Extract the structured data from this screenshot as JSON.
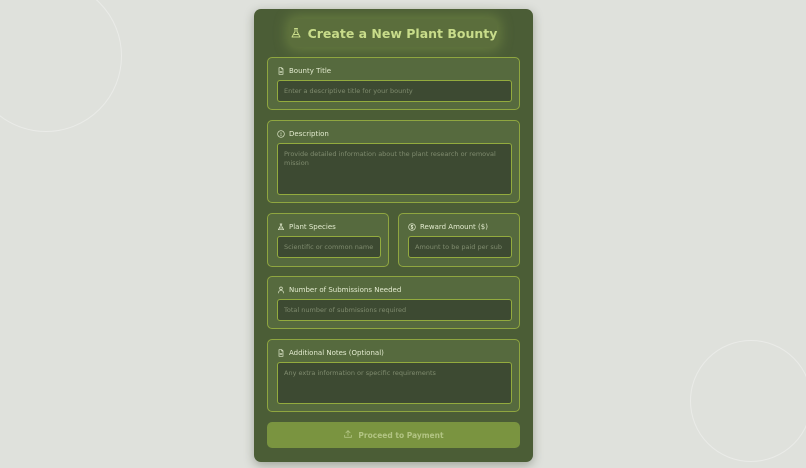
{
  "form": {
    "title": "Create a New Plant Bounty",
    "title_icon": "flask-icon",
    "fields": {
      "bounty_title": {
        "label": "Bounty Title",
        "icon": "document-icon",
        "placeholder": "Enter a descriptive title for your bounty",
        "value": ""
      },
      "description": {
        "label": "Description",
        "icon": "info-icon",
        "placeholder": "Provide detailed information about the plant research or removal mission",
        "value": ""
      },
      "plant_species": {
        "label": "Plant Species",
        "icon": "flask-icon",
        "placeholder": "Scientific or common name",
        "value": ""
      },
      "reward_amount": {
        "label": "Reward Amount ($)",
        "icon": "dollar-icon",
        "placeholder": "Amount to be paid per sub",
        "value": ""
      },
      "submissions_needed": {
        "label": "Number of Submissions Needed",
        "icon": "user-icon",
        "placeholder": "Total number of submissions required",
        "value": ""
      },
      "additional_notes": {
        "label": "Additional Notes (Optional)",
        "icon": "document-icon",
        "placeholder": "Any extra information or specific requirements",
        "value": ""
      }
    },
    "submit": {
      "label": "Proceed to Payment",
      "icon": "upload-icon"
    }
  },
  "colors": {
    "page_background": "#dfe1dc",
    "card_background": "#4b5d36",
    "accent_border": "#8fa640",
    "title_text": "#c8dc8a",
    "button_background": "#7a9440"
  }
}
